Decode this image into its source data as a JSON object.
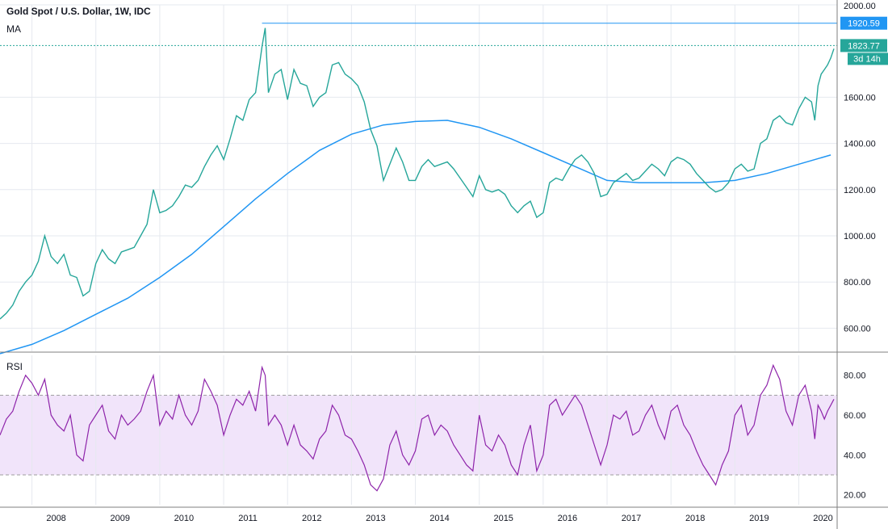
{
  "chart_data": {
    "type": "line",
    "title": "Gold Spot / U.S. Dollar, 1W, IDC",
    "indicator_label": "MA",
    "price_panel": {
      "ylim": [
        500,
        2000
      ],
      "yticks": [
        "600.00",
        "800.00",
        "1000.00",
        "1200.00",
        "1400.00",
        "1600.00",
        "2000.00"
      ],
      "top_label": "2000.00",
      "price_line": {
        "name": "Gold price (weekly close)",
        "color": "#26a69a"
      },
      "ma_line": {
        "name": "MA",
        "color": "#2196f3"
      },
      "price_points": [
        [
          2007.5,
          640
        ],
        [
          2007.6,
          665
        ],
        [
          2007.7,
          700
        ],
        [
          2007.8,
          760
        ],
        [
          2007.9,
          800
        ],
        [
          2008.0,
          830
        ],
        [
          2008.1,
          890
        ],
        [
          2008.2,
          1000
        ],
        [
          2008.3,
          910
        ],
        [
          2008.4,
          880
        ],
        [
          2008.5,
          920
        ],
        [
          2008.6,
          830
        ],
        [
          2008.7,
          820
        ],
        [
          2008.8,
          740
        ],
        [
          2008.9,
          760
        ],
        [
          2009.0,
          880
        ],
        [
          2009.1,
          940
        ],
        [
          2009.2,
          900
        ],
        [
          2009.3,
          880
        ],
        [
          2009.4,
          930
        ],
        [
          2009.5,
          940
        ],
        [
          2009.6,
          950
        ],
        [
          2009.7,
          1000
        ],
        [
          2009.8,
          1050
        ],
        [
          2009.9,
          1200
        ],
        [
          2010.0,
          1100
        ],
        [
          2010.1,
          1110
        ],
        [
          2010.2,
          1130
        ],
        [
          2010.3,
          1170
        ],
        [
          2010.4,
          1220
        ],
        [
          2010.5,
          1210
        ],
        [
          2010.6,
          1240
        ],
        [
          2010.7,
          1300
        ],
        [
          2010.8,
          1350
        ],
        [
          2010.9,
          1390
        ],
        [
          2011.0,
          1330
        ],
        [
          2011.1,
          1420
        ],
        [
          2011.2,
          1520
        ],
        [
          2011.3,
          1500
        ],
        [
          2011.4,
          1590
        ],
        [
          2011.5,
          1620
        ],
        [
          2011.6,
          1820
        ],
        [
          2011.65,
          1900
        ],
        [
          2011.7,
          1620
        ],
        [
          2011.8,
          1700
        ],
        [
          2011.9,
          1720
        ],
        [
          2012.0,
          1590
        ],
        [
          2012.1,
          1720
        ],
        [
          2012.2,
          1660
        ],
        [
          2012.3,
          1650
        ],
        [
          2012.4,
          1560
        ],
        [
          2012.5,
          1600
        ],
        [
          2012.6,
          1620
        ],
        [
          2012.7,
          1740
        ],
        [
          2012.8,
          1750
        ],
        [
          2012.9,
          1700
        ],
        [
          2013.0,
          1680
        ],
        [
          2013.1,
          1650
        ],
        [
          2013.2,
          1580
        ],
        [
          2013.3,
          1460
        ],
        [
          2013.4,
          1390
        ],
        [
          2013.5,
          1240
        ],
        [
          2013.6,
          1310
        ],
        [
          2013.7,
          1380
        ],
        [
          2013.8,
          1320
        ],
        [
          2013.9,
          1240
        ],
        [
          2014.0,
          1240
        ],
        [
          2014.1,
          1300
        ],
        [
          2014.2,
          1330
        ],
        [
          2014.3,
          1300
        ],
        [
          2014.4,
          1310
        ],
        [
          2014.5,
          1320
        ],
        [
          2014.6,
          1290
        ],
        [
          2014.7,
          1250
        ],
        [
          2014.8,
          1210
        ],
        [
          2014.9,
          1170
        ],
        [
          2015.0,
          1260
        ],
        [
          2015.1,
          1200
        ],
        [
          2015.2,
          1190
        ],
        [
          2015.3,
          1200
        ],
        [
          2015.4,
          1180
        ],
        [
          2015.5,
          1130
        ],
        [
          2015.6,
          1100
        ],
        [
          2015.7,
          1130
        ],
        [
          2015.8,
          1150
        ],
        [
          2015.9,
          1080
        ],
        [
          2016.0,
          1100
        ],
        [
          2016.1,
          1230
        ],
        [
          2016.2,
          1250
        ],
        [
          2016.3,
          1240
        ],
        [
          2016.4,
          1290
        ],
        [
          2016.5,
          1330
        ],
        [
          2016.6,
          1350
        ],
        [
          2016.7,
          1320
        ],
        [
          2016.8,
          1270
        ],
        [
          2016.9,
          1170
        ],
        [
          2017.0,
          1180
        ],
        [
          2017.1,
          1230
        ],
        [
          2017.2,
          1250
        ],
        [
          2017.3,
          1270
        ],
        [
          2017.4,
          1240
        ],
        [
          2017.5,
          1250
        ],
        [
          2017.6,
          1280
        ],
        [
          2017.7,
          1310
        ],
        [
          2017.8,
          1290
        ],
        [
          2017.9,
          1260
        ],
        [
          2018.0,
          1320
        ],
        [
          2018.1,
          1340
        ],
        [
          2018.2,
          1330
        ],
        [
          2018.3,
          1310
        ],
        [
          2018.4,
          1270
        ],
        [
          2018.5,
          1240
        ],
        [
          2018.6,
          1210
        ],
        [
          2018.7,
          1190
        ],
        [
          2018.8,
          1200
        ],
        [
          2018.9,
          1230
        ],
        [
          2019.0,
          1290
        ],
        [
          2019.1,
          1310
        ],
        [
          2019.2,
          1280
        ],
        [
          2019.3,
          1290
        ],
        [
          2019.4,
          1400
        ],
        [
          2019.5,
          1420
        ],
        [
          2019.6,
          1500
        ],
        [
          2019.7,
          1520
        ],
        [
          2019.8,
          1490
        ],
        [
          2019.9,
          1480
        ],
        [
          2020.0,
          1550
        ],
        [
          2020.1,
          1600
        ],
        [
          2020.2,
          1580
        ],
        [
          2020.25,
          1500
        ],
        [
          2020.3,
          1650
        ],
        [
          2020.35,
          1700
        ],
        [
          2020.4,
          1720
        ],
        [
          2020.45,
          1740
        ],
        [
          2020.5,
          1770
        ],
        [
          2020.55,
          1810
        ]
      ],
      "ma_points": [
        [
          2007.5,
          490
        ],
        [
          2008.0,
          530
        ],
        [
          2008.5,
          590
        ],
        [
          2009.0,
          660
        ],
        [
          2009.5,
          730
        ],
        [
          2010.0,
          820
        ],
        [
          2010.5,
          920
        ],
        [
          2011.0,
          1040
        ],
        [
          2011.5,
          1160
        ],
        [
          2012.0,
          1270
        ],
        [
          2012.5,
          1370
        ],
        [
          2013.0,
          1440
        ],
        [
          2013.5,
          1480
        ],
        [
          2014.0,
          1495
        ],
        [
          2014.5,
          1500
        ],
        [
          2015.0,
          1470
        ],
        [
          2015.5,
          1420
        ],
        [
          2016.0,
          1360
        ],
        [
          2016.5,
          1300
        ],
        [
          2017.0,
          1240
        ],
        [
          2017.5,
          1230
        ],
        [
          2018.0,
          1230
        ],
        [
          2018.5,
          1230
        ],
        [
          2019.0,
          1240
        ],
        [
          2019.5,
          1270
        ],
        [
          2020.0,
          1310
        ],
        [
          2020.5,
          1350
        ]
      ],
      "horizontal_lines": [
        {
          "value": 1920.59,
          "label": "1920.59",
          "color": "#2196f3",
          "style": "solid",
          "start_x": 2011.6
        },
        {
          "value": 1823.77,
          "label": "1823.77",
          "color": "#26a69a",
          "style": "dotted",
          "start_x": 2007.5
        }
      ],
      "countdown_label": "3d 14h"
    },
    "rsi_panel": {
      "label": "RSI",
      "ylim": [
        15,
        90
      ],
      "yticks": [
        "20.00",
        "40.00",
        "60.00",
        "80.00"
      ],
      "band": [
        30,
        70
      ],
      "band_color": "#ead6f7",
      "line_color": "#8e24aa",
      "points": [
        [
          2007.5,
          50
        ],
        [
          2007.6,
          58
        ],
        [
          2007.7,
          62
        ],
        [
          2007.8,
          72
        ],
        [
          2007.9,
          80
        ],
        [
          2008.0,
          76
        ],
        [
          2008.1,
          70
        ],
        [
          2008.2,
          78
        ],
        [
          2008.3,
          60
        ],
        [
          2008.4,
          55
        ],
        [
          2008.5,
          52
        ],
        [
          2008.6,
          60
        ],
        [
          2008.7,
          40
        ],
        [
          2008.8,
          37
        ],
        [
          2008.9,
          55
        ],
        [
          2009.0,
          60
        ],
        [
          2009.1,
          65
        ],
        [
          2009.2,
          52
        ],
        [
          2009.3,
          48
        ],
        [
          2009.4,
          60
        ],
        [
          2009.5,
          55
        ],
        [
          2009.6,
          58
        ],
        [
          2009.7,
          62
        ],
        [
          2009.8,
          72
        ],
        [
          2009.9,
          80
        ],
        [
          2010.0,
          55
        ],
        [
          2010.1,
          62
        ],
        [
          2010.2,
          58
        ],
        [
          2010.3,
          70
        ],
        [
          2010.4,
          60
        ],
        [
          2010.5,
          55
        ],
        [
          2010.6,
          62
        ],
        [
          2010.7,
          78
        ],
        [
          2010.8,
          72
        ],
        [
          2010.9,
          65
        ],
        [
          2011.0,
          50
        ],
        [
          2011.1,
          60
        ],
        [
          2011.2,
          68
        ],
        [
          2011.3,
          65
        ],
        [
          2011.4,
          72
        ],
        [
          2011.5,
          62
        ],
        [
          2011.6,
          84
        ],
        [
          2011.65,
          80
        ],
        [
          2011.7,
          55
        ],
        [
          2011.8,
          60
        ],
        [
          2011.9,
          55
        ],
        [
          2012.0,
          45
        ],
        [
          2012.1,
          55
        ],
        [
          2012.2,
          45
        ],
        [
          2012.3,
          42
        ],
        [
          2012.4,
          38
        ],
        [
          2012.5,
          48
        ],
        [
          2012.6,
          52
        ],
        [
          2012.7,
          65
        ],
        [
          2012.8,
          60
        ],
        [
          2012.9,
          50
        ],
        [
          2013.0,
          48
        ],
        [
          2013.1,
          42
        ],
        [
          2013.2,
          35
        ],
        [
          2013.3,
          25
        ],
        [
          2013.4,
          22
        ],
        [
          2013.5,
          28
        ],
        [
          2013.6,
          45
        ],
        [
          2013.7,
          52
        ],
        [
          2013.8,
          40
        ],
        [
          2013.9,
          35
        ],
        [
          2014.0,
          42
        ],
        [
          2014.1,
          58
        ],
        [
          2014.2,
          60
        ],
        [
          2014.3,
          50
        ],
        [
          2014.4,
          55
        ],
        [
          2014.5,
          52
        ],
        [
          2014.6,
          45
        ],
        [
          2014.7,
          40
        ],
        [
          2014.8,
          35
        ],
        [
          2014.9,
          32
        ],
        [
          2015.0,
          60
        ],
        [
          2015.1,
          45
        ],
        [
          2015.2,
          42
        ],
        [
          2015.3,
          50
        ],
        [
          2015.4,
          45
        ],
        [
          2015.5,
          35
        ],
        [
          2015.6,
          30
        ],
        [
          2015.7,
          45
        ],
        [
          2015.8,
          55
        ],
        [
          2015.9,
          32
        ],
        [
          2016.0,
          40
        ],
        [
          2016.1,
          65
        ],
        [
          2016.2,
          68
        ],
        [
          2016.3,
          60
        ],
        [
          2016.4,
          65
        ],
        [
          2016.5,
          70
        ],
        [
          2016.6,
          65
        ],
        [
          2016.7,
          55
        ],
        [
          2016.8,
          45
        ],
        [
          2016.9,
          35
        ],
        [
          2017.0,
          45
        ],
        [
          2017.1,
          60
        ],
        [
          2017.2,
          58
        ],
        [
          2017.3,
          62
        ],
        [
          2017.4,
          50
        ],
        [
          2017.5,
          52
        ],
        [
          2017.6,
          60
        ],
        [
          2017.7,
          65
        ],
        [
          2017.8,
          55
        ],
        [
          2017.9,
          48
        ],
        [
          2018.0,
          62
        ],
        [
          2018.1,
          65
        ],
        [
          2018.2,
          55
        ],
        [
          2018.3,
          50
        ],
        [
          2018.4,
          42
        ],
        [
          2018.5,
          35
        ],
        [
          2018.6,
          30
        ],
        [
          2018.7,
          25
        ],
        [
          2018.8,
          35
        ],
        [
          2018.9,
          42
        ],
        [
          2019.0,
          60
        ],
        [
          2019.1,
          65
        ],
        [
          2019.2,
          50
        ],
        [
          2019.3,
          55
        ],
        [
          2019.4,
          70
        ],
        [
          2019.5,
          75
        ],
        [
          2019.6,
          85
        ],
        [
          2019.7,
          78
        ],
        [
          2019.8,
          62
        ],
        [
          2019.9,
          55
        ],
        [
          2020.0,
          70
        ],
        [
          2020.1,
          75
        ],
        [
          2020.2,
          62
        ],
        [
          2020.25,
          48
        ],
        [
          2020.3,
          65
        ],
        [
          2020.35,
          62
        ],
        [
          2020.4,
          58
        ],
        [
          2020.45,
          62
        ],
        [
          2020.5,
          65
        ],
        [
          2020.55,
          68
        ]
      ]
    },
    "x_axis": {
      "xlim": [
        2007.5,
        2020.6
      ],
      "year_labels": [
        "2008",
        "2009",
        "2010",
        "2011",
        "2012",
        "2013",
        "2014",
        "2015",
        "2016",
        "2017",
        "2018",
        "2019",
        "2020"
      ],
      "year_positions": [
        2008,
        2009,
        2010,
        2011,
        2012,
        2013,
        2014,
        2015,
        2016,
        2017,
        2018,
        2019,
        2020
      ]
    },
    "grid": true,
    "colors": {
      "grid": "#e6e9ef",
      "axis_border": "#7f7f7f",
      "text": "#131722",
      "tag_blue": "#2196f3",
      "tag_green": "#26a69a"
    }
  }
}
